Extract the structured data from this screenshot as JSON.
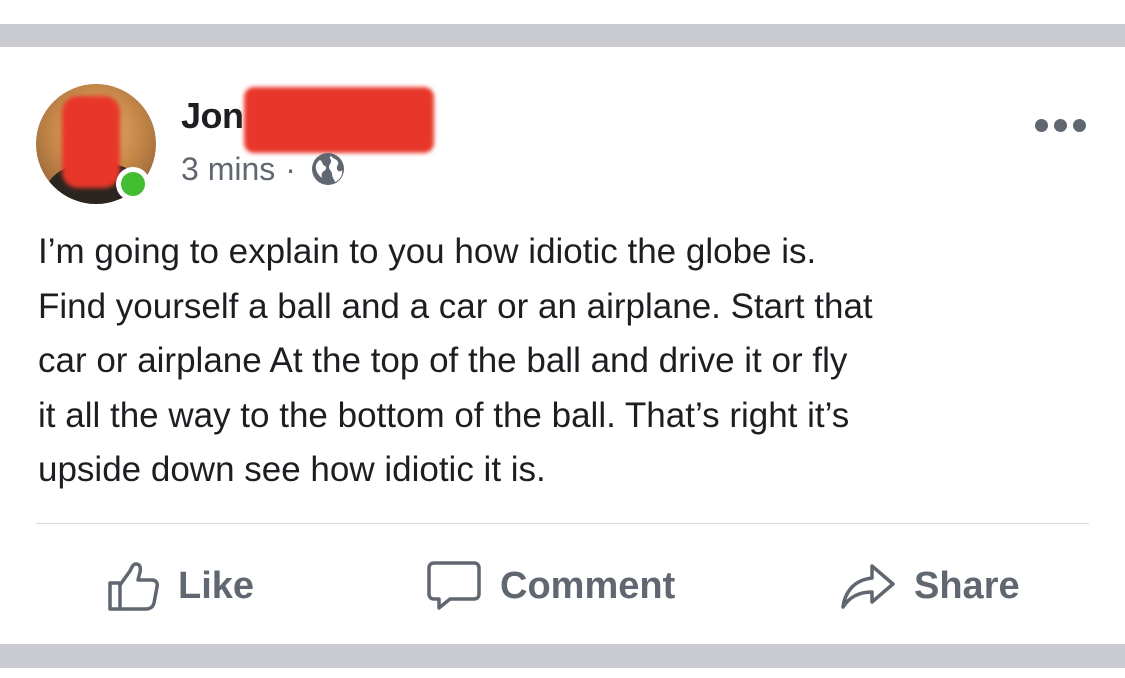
{
  "post": {
    "author_name_visible": "Jon",
    "timestamp": "3 mins",
    "meta_separator": "·",
    "privacy_icon": "globe-icon",
    "more_icon": "more-options-icon",
    "online_status_color": "#44bd32",
    "text": "I’m going to explain to you how idiotic the globe is.\nFind yourself a ball and a car or an airplane. Start that\ncar or airplane At the top of the ball and drive it or fly\nit all the way to the bottom of the ball. That’s right it’s\nupside down see how idiotic it is."
  },
  "actions": {
    "like_label": "Like",
    "comment_label": "Comment",
    "share_label": "Share"
  },
  "colors": {
    "text_primary": "#1c1e21",
    "text_secondary": "#606770",
    "divider_band": "#cacbd0",
    "redaction": "#e8372a"
  }
}
